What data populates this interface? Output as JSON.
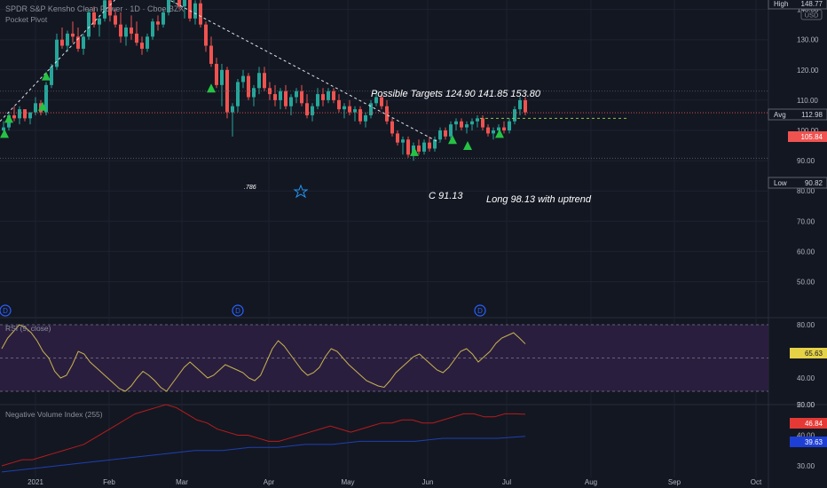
{
  "header": {
    "symbol": "SPDR S&P Kensho Clean Power",
    "interval": "1D",
    "exchange": "Cboe BZX",
    "indicator": "Pocket Pivot"
  },
  "colors": {
    "background": "#131722",
    "up": "#26a69a",
    "down": "#ef5350",
    "pivot_marker": "#26c244",
    "rsi_line": "#c9b44e",
    "rsi_band": "#2a1e3f",
    "nvi_line": "#b71c1c",
    "nvi_signal": "#1e40b0",
    "grid": "#1e2230",
    "axis_text": "#b2b5be"
  },
  "annotations": {
    "targets": "Possible Targets  124.90  141.85  153.80",
    "c_level": "C 91.13",
    "long_note": "Long 98.13 with uptrend",
    "fib": ".786"
  },
  "price_labels": {
    "high": "High",
    "high_value": "148.77",
    "usd": "USD",
    "avg": "Avg",
    "avg_value": "112.98",
    "last_value": "105.84",
    "low": "Low",
    "low_value": "90.82"
  },
  "rsi": {
    "title": "RSI (9, close)",
    "value": "65.63"
  },
  "nvi": {
    "title": "Negative Volume Index (255)",
    "value1": "46.84",
    "value2": "39.63"
  },
  "dividend_marker": "D",
  "chart_data": {
    "type": "candlestick",
    "title": "SPDR S&P Kensho Clean Power · 1D · Cboe BZX",
    "x_ticks": [
      "2021",
      "Feb",
      "Mar",
      "Apr",
      "May",
      "Jun",
      "Jul",
      "Aug",
      "Sep",
      "Oct"
    ],
    "price_ticks": [
      140.0,
      130.0,
      120.0,
      110.0,
      100.0,
      90.0,
      80.0,
      70.0,
      60.0,
      50.0
    ],
    "price_range": [
      45,
      150
    ],
    "candles": [
      [
        100,
        103,
        98,
        101
      ],
      [
        101,
        106,
        100,
        105
      ],
      [
        105,
        108,
        103,
        104
      ],
      [
        104,
        108,
        102,
        107
      ],
      [
        107,
        107,
        103,
        104
      ],
      [
        104,
        106,
        102,
        106
      ],
      [
        106,
        111,
        105,
        109
      ],
      [
        109,
        110,
        105,
        106
      ],
      [
        106,
        116,
        105,
        115
      ],
      [
        115,
        122,
        114,
        121
      ],
      [
        121,
        132,
        120,
        130
      ],
      [
        130,
        134,
        127,
        128
      ],
      [
        128,
        133,
        126,
        132
      ],
      [
        132,
        136,
        129,
        131
      ],
      [
        131,
        134,
        126,
        127
      ],
      [
        127,
        132,
        125,
        131
      ],
      [
        131,
        140,
        130,
        139
      ],
      [
        139,
        141,
        134,
        135
      ],
      [
        135,
        138,
        131,
        137
      ],
      [
        137,
        145,
        136,
        143
      ],
      [
        143,
        144,
        136,
        138
      ],
      [
        138,
        140,
        134,
        135
      ],
      [
        135,
        139,
        129,
        131
      ],
      [
        131,
        135,
        128,
        134
      ],
      [
        134,
        138,
        130,
        132
      ],
      [
        132,
        136,
        128,
        129
      ],
      [
        129,
        131,
        125,
        127
      ],
      [
        127,
        132,
        126,
        131
      ],
      [
        131,
        137,
        130,
        136
      ],
      [
        136,
        138,
        133,
        135
      ],
      [
        135,
        140,
        134,
        139
      ],
      [
        139,
        145,
        138,
        144
      ],
      [
        144,
        149,
        142,
        146
      ],
      [
        146,
        148,
        140,
        141
      ],
      [
        141,
        145,
        137,
        144
      ],
      [
        144,
        146,
        136,
        137
      ],
      [
        137,
        143,
        135,
        142
      ],
      [
        142,
        144,
        134,
        135
      ],
      [
        135,
        136,
        126,
        128
      ],
      [
        128,
        131,
        121,
        122
      ],
      [
        122,
        124,
        114,
        115
      ],
      [
        115,
        122,
        108,
        120
      ],
      [
        120,
        121,
        104,
        106
      ],
      [
        106,
        109,
        98,
        108
      ],
      [
        108,
        117,
        106,
        116
      ],
      [
        116,
        120,
        114,
        118
      ],
      [
        118,
        119,
        110,
        111
      ],
      [
        111,
        115,
        108,
        114
      ],
      [
        114,
        121,
        112,
        119
      ],
      [
        119,
        121,
        113,
        114
      ],
      [
        114,
        116,
        110,
        112
      ],
      [
        112,
        115,
        108,
        110
      ],
      [
        110,
        114,
        107,
        113
      ],
      [
        113,
        115,
        107,
        108
      ],
      [
        108,
        112,
        105,
        111
      ],
      [
        111,
        114,
        109,
        113
      ],
      [
        113,
        115,
        108,
        109
      ],
      [
        109,
        112,
        104,
        105
      ],
      [
        105,
        109,
        103,
        108
      ],
      [
        108,
        114,
        107,
        112
      ],
      [
        112,
        114,
        108,
        110
      ],
      [
        110,
        114,
        109,
        113
      ],
      [
        113,
        114,
        109,
        110
      ],
      [
        110,
        112,
        106,
        107
      ],
      [
        107,
        109,
        104,
        108
      ],
      [
        108,
        110,
        105,
        106
      ],
      [
        106,
        108,
        103,
        107
      ],
      [
        107,
        108,
        102,
        103
      ],
      [
        103,
        106,
        101,
        105
      ],
      [
        105,
        110,
        104,
        109
      ],
      [
        109,
        113,
        108,
        111
      ],
      [
        111,
        112,
        107,
        108
      ],
      [
        108,
        110,
        102,
        103
      ],
      [
        103,
        104,
        98,
        99
      ],
      [
        99,
        100,
        95,
        96
      ],
      [
        96,
        98,
        92,
        97
      ],
      [
        97,
        98,
        91,
        92
      ],
      [
        92,
        96,
        90,
        95
      ],
      [
        95,
        97,
        92,
        93
      ],
      [
        93,
        97,
        92,
        96
      ],
      [
        96,
        98,
        93,
        94
      ],
      [
        94,
        98,
        93,
        97
      ],
      [
        97,
        101,
        96,
        100
      ],
      [
        100,
        101,
        97,
        98
      ],
      [
        98,
        103,
        97,
        102
      ],
      [
        102,
        104,
        100,
        103
      ],
      [
        103,
        104,
        100,
        101
      ],
      [
        101,
        103,
        99,
        102
      ],
      [
        102,
        104,
        100,
        103
      ],
      [
        103,
        105,
        101,
        104
      ],
      [
        104,
        105,
        100,
        101
      ],
      [
        101,
        102,
        98,
        99
      ],
      [
        99,
        101,
        97,
        100
      ],
      [
        100,
        102,
        98,
        101
      ],
      [
        101,
        103,
        99,
        100
      ],
      [
        100,
        104,
        99,
        103
      ],
      [
        103,
        108,
        102,
        107
      ],
      [
        107,
        111,
        105,
        110
      ],
      [
        110,
        111,
        105,
        106
      ]
    ],
    "horizontal_levels": {
      "high": 148.77,
      "avg": 112.98,
      "low": 90.82,
      "last": 105.84,
      "target_dashed": 104.0
    },
    "rsi_series": [
      62,
      70,
      75,
      80,
      78,
      74,
      68,
      60,
      55,
      45,
      40,
      42,
      50,
      60,
      58,
      52,
      48,
      44,
      40,
      36,
      32,
      30,
      34,
      40,
      45,
      42,
      38,
      33,
      30,
      36,
      42,
      48,
      52,
      48,
      44,
      40,
      42,
      46,
      50,
      48,
      46,
      44,
      40,
      38,
      42,
      52,
      62,
      68,
      64,
      58,
      52,
      46,
      42,
      44,
      48,
      56,
      62,
      60,
      55,
      50,
      46,
      42,
      38,
      36,
      34,
      33,
      38,
      44,
      48,
      52,
      56,
      58,
      54,
      50,
      46,
      44,
      48,
      54,
      60,
      62,
      58,
      52,
      56,
      60,
      66,
      70,
      72,
      74,
      70,
      65.63
    ],
    "rsi_ticks": [
      80.0,
      60.0,
      40.0,
      20.0
    ],
    "rsi_bands": [
      70,
      30
    ],
    "nvi_series": [
      30,
      31,
      32,
      32,
      33,
      34,
      35,
      36,
      37,
      39,
      41,
      43,
      45,
      47,
      48,
      49,
      50,
      49,
      47,
      45,
      44,
      42,
      41,
      40,
      40,
      39,
      38,
      38,
      39,
      40,
      41,
      42,
      43,
      42,
      41,
      42,
      43,
      44,
      44,
      45,
      45,
      44,
      44,
      45,
      46,
      47,
      47,
      46,
      46,
      47,
      47,
      46.84
    ],
    "nvi_signal": [
      28,
      29,
      30,
      31,
      32,
      33,
      34,
      35,
      35,
      36,
      36,
      37,
      37,
      38,
      38,
      38,
      39,
      39,
      39,
      39.63
    ],
    "nvi_ticks": [
      50.0,
      40.0,
      30.0
    ]
  }
}
